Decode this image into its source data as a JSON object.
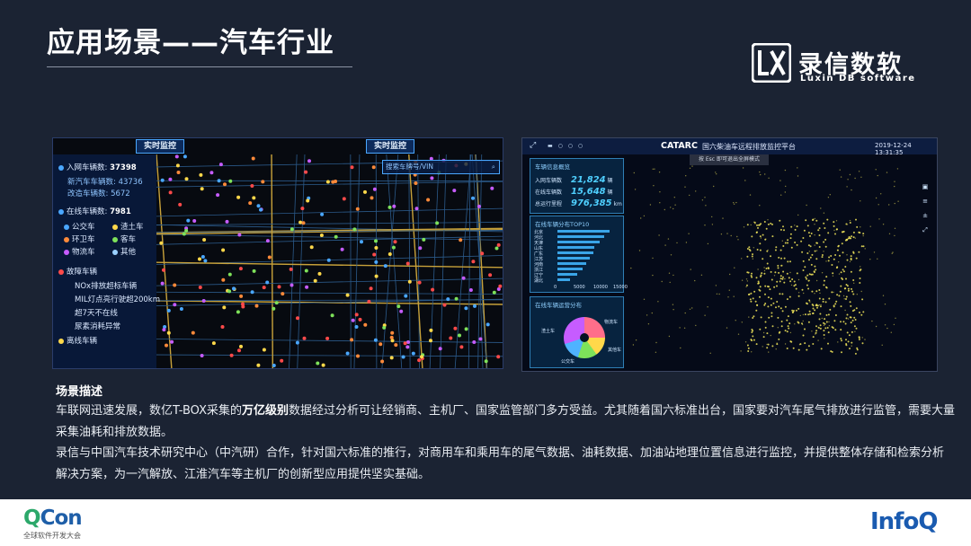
{
  "slide": {
    "title": "应用场景——汽车行业"
  },
  "logo": {
    "mark": "LX",
    "name_cn": "录信数软",
    "name_en": "Luxin DB software"
  },
  "left_screenshot": {
    "tags": [
      "实时监控",
      "实时监控"
    ],
    "search_placeholder": "搜索车牌号/VIN",
    "rows": [
      {
        "label": "入网车辆数:",
        "value": "37398"
      },
      {
        "label": "新汽车车辆数:",
        "value": "43736"
      },
      {
        "label": "改造车辆数:",
        "value": "5672"
      },
      {
        "label": "在线车辆数:",
        "value": "7981"
      },
      {
        "label": "公交车"
      },
      {
        "label": "渣土车"
      },
      {
        "label": "环卫车"
      },
      {
        "label": "客车"
      },
      {
        "label": "物流车"
      },
      {
        "label": "其他"
      },
      {
        "label": "故障车辆"
      },
      {
        "label": "NOx排放超标车辆"
      },
      {
        "label": "MIL灯点亮行驶超200km"
      },
      {
        "label": "超7天不在线"
      },
      {
        "label": "尿素消耗异常"
      },
      {
        "label": "离线车辆"
      }
    ]
  },
  "right_screenshot": {
    "brand": "CATARC",
    "title": "国六柴油车远程排放监控平台",
    "datetime": "2019-12-24  13:31:35",
    "tip": "按 Esc 即可退出全屏模式",
    "overview_title": "车辆信息概览",
    "stats": [
      {
        "label": "入网车辆数",
        "value": "21,824",
        "unit": "辆"
      },
      {
        "label": "在线车辆数",
        "value": "15,648",
        "unit": "辆"
      },
      {
        "label": "总运行里程",
        "value": "976,385",
        "unit": "km"
      }
    ],
    "top_title": "在线车辆分布TOP10",
    "top_bars": [
      {
        "label": "北京",
        "value": 12835
      },
      {
        "label": "河北",
        "value": 11369
      },
      {
        "label": "天津",
        "value": 10469
      },
      {
        "label": "山东",
        "value": 9021
      },
      {
        "label": "广东",
        "value": 8800
      },
      {
        "label": "江苏",
        "value": 7848
      },
      {
        "label": "河南",
        "value": 7144
      },
      {
        "label": "浙江",
        "value": 6201
      },
      {
        "label": "辽宁",
        "value": 4896
      },
      {
        "label": "湖北",
        "value": 3127
      }
    ],
    "top_axis": [
      "0",
      "5000",
      "10000",
      "15000"
    ],
    "pie_title": "在线车辆运营分布",
    "pie_labels": [
      "物流车",
      "其他车",
      "渣土车",
      "公交车"
    ]
  },
  "description": {
    "heading": "场景描述",
    "p1_before": "车联网迅速发展，数亿T-BOX采集的",
    "p1_bold": "万亿级别",
    "p1_after": "数据经过分析可让经销商、主机厂、国家监管部门多方受益。尤其随着国六标准出台，国家要对汽车尾气排放进行监管，需要大量采集油耗和排放数据。",
    "p2": "录信与中国汽车技术研究中心（中汽研）合作，针对国六标准的推行，对商用车和乘用车的尾气数据、油耗数据、加油站地理位置信息进行监控，并提供整体存储和检索分析解决方案，为一汽解放、江淮汽车等主机厂的创新型应用提供坚实基础。"
  },
  "footer": {
    "qcon_q": "Q",
    "qcon_rest": "Con",
    "qcon_sub": "全球软件开发大会",
    "infoq": "InfoQ"
  },
  "colors": {
    "background": "#1b2333",
    "accent_blue": "#4aa7ff",
    "map_points": "#f2e65a"
  }
}
